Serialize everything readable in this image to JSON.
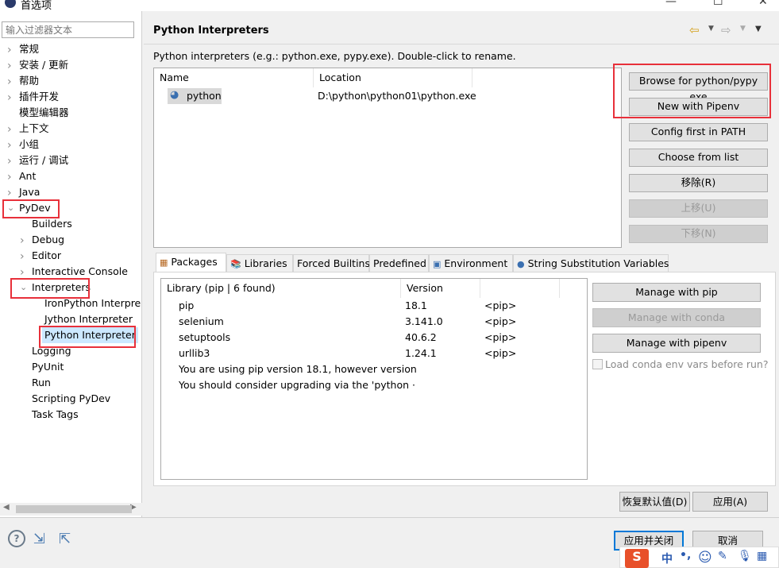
{
  "window": {
    "title": "首选项"
  },
  "filter": {
    "placeholder": "输入过滤器文本"
  },
  "tree": [
    {
      "label": "常规",
      "level": 0,
      "expander": "closed"
    },
    {
      "label": "安装 / 更新",
      "level": 0,
      "expander": "closed"
    },
    {
      "label": "帮助",
      "level": 0,
      "expander": "closed"
    },
    {
      "label": "插件开发",
      "level": 0,
      "expander": "closed"
    },
    {
      "label": "模型编辑器",
      "level": 0,
      "expander": "none"
    },
    {
      "label": "上下文",
      "level": 0,
      "expander": "closed"
    },
    {
      "label": "小组",
      "level": 0,
      "expander": "closed"
    },
    {
      "label": "运行 / 调试",
      "level": 0,
      "expander": "closed"
    },
    {
      "label": "Ant",
      "level": 0,
      "expander": "closed"
    },
    {
      "label": "Java",
      "level": 0,
      "expander": "closed"
    },
    {
      "label": "PyDev",
      "level": 0,
      "expander": "open"
    },
    {
      "label": "Builders",
      "level": 1,
      "expander": "none"
    },
    {
      "label": "Debug",
      "level": 1,
      "expander": "closed"
    },
    {
      "label": "Editor",
      "level": 1,
      "expander": "closed"
    },
    {
      "label": "Interactive Console",
      "level": 1,
      "expander": "closed"
    },
    {
      "label": "Interpreters",
      "level": 1,
      "expander": "open"
    },
    {
      "label": "IronPython Interpre",
      "level": 2,
      "expander": "none"
    },
    {
      "label": "Jython Interpreter",
      "level": 2,
      "expander": "none"
    },
    {
      "label": "Python Interpreter",
      "level": 2,
      "expander": "none",
      "selected": true
    },
    {
      "label": "Logging",
      "level": 1,
      "expander": "none"
    },
    {
      "label": "PyUnit",
      "level": 1,
      "expander": "none"
    },
    {
      "label": "Run",
      "level": 1,
      "expander": "none"
    },
    {
      "label": "Scripting PyDev",
      "level": 1,
      "expander": "none"
    },
    {
      "label": "Task Tags",
      "level": 1,
      "expander": "none"
    }
  ],
  "page": {
    "title": "Python Interpreters",
    "description": "Python interpreters (e.g.: python.exe, pypy.exe).   Double-click to rename."
  },
  "interpreters": {
    "columns": [
      "Name",
      "Location"
    ],
    "rows": [
      {
        "name": "python",
        "location": "D:\\python\\python01\\python.exe"
      }
    ]
  },
  "interp_buttons": [
    {
      "label": "Browse for python/pypy exe",
      "enabled": true
    },
    {
      "label": "New with Pipenv",
      "enabled": true
    },
    {
      "label": "Config first in PATH",
      "enabled": true
    },
    {
      "label": "Choose from list",
      "enabled": true
    },
    {
      "label": "移除(R)",
      "enabled": true
    },
    {
      "label": "上移(U)",
      "enabled": false
    },
    {
      "label": "下移(N)",
      "enabled": false
    }
  ],
  "tabs": [
    {
      "label": "Packages",
      "icon": "package-icon",
      "active": true
    },
    {
      "label": "Libraries",
      "icon": "books-icon"
    },
    {
      "label": "Forced Builtins"
    },
    {
      "label": "Predefined"
    },
    {
      "label": "Environment",
      "icon": "environment-icon"
    },
    {
      "label": "String Substitution Variables",
      "icon": "blue-dot-icon"
    }
  ],
  "packages": {
    "columns": [
      "Library (pip | 6 found)",
      "Version",
      ""
    ],
    "rows": [
      {
        "name": "pip",
        "version": "18.1",
        "source": "<pip>"
      },
      {
        "name": "selenium",
        "version": "3.141.0",
        "source": "<pip>"
      },
      {
        "name": "setuptools",
        "version": "40.6.2",
        "source": "<pip>"
      },
      {
        "name": "urllib3",
        "version": "1.24.1",
        "source": "<pip>"
      },
      {
        "name": "You are using pip version 18.1, however version",
        "version": "",
        "source": ""
      },
      {
        "name": "You should consider upgrading via the 'python ·",
        "version": "",
        "source": ""
      }
    ]
  },
  "pkg_buttons": [
    {
      "label": "Manage with pip",
      "enabled": true
    },
    {
      "label": "Manage with conda",
      "enabled": false
    },
    {
      "label": "Manage with pipenv",
      "enabled": true
    }
  ],
  "conda_checkbox": {
    "label": "Load conda env vars before run?",
    "checked": false,
    "enabled": false
  },
  "footer": {
    "restore": "恢复默认值(D)",
    "apply": "应用(A)",
    "apply_close": "应用并关闭",
    "cancel": "取消"
  },
  "ime": {
    "mode": "中",
    "punct": "•,"
  },
  "colors": {
    "highlight": "#e8303a",
    "selection": "#cce8ff",
    "default_button_border": "#0078d7"
  }
}
